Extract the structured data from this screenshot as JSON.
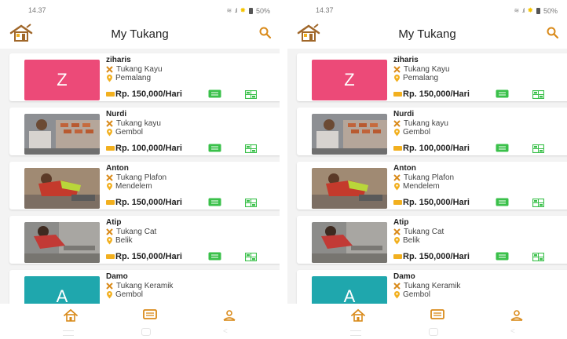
{
  "status_bar": {
    "time": "14.37",
    "battery": "50%"
  },
  "header": {
    "title": "My Tukang"
  },
  "colors": {
    "accent": "#d98a1a",
    "chat_green": "#3ac04a",
    "avatar_pink": "#ec4a78",
    "avatar_teal": "#1fa7ad"
  },
  "tukang": [
    {
      "name": "ziharis",
      "skill": "Tukang Kayu",
      "location": "Pemalang",
      "price": "Rp. 150,000/Hari",
      "avatar_letter": "Z"
    },
    {
      "name": "Nurdi",
      "skill": "Tukang kayu",
      "location": "Gembol",
      "price": "Rp. 100,000/Hari"
    },
    {
      "name": "Anton",
      "skill": "Tukang Plafon",
      "location": "Mendelem",
      "price": "Rp. 150,000/Hari"
    },
    {
      "name": "Atip",
      "skill": "Tukang Cat",
      "location": "Belik",
      "price": "Rp. 150,000/Hari"
    },
    {
      "name": "Damo",
      "skill": "Tukang Keramik",
      "location": "Gembol",
      "avatar_letter": "A"
    }
  ],
  "bottom_nav": [
    "home-icon",
    "chat-icon",
    "profile-icon"
  ]
}
